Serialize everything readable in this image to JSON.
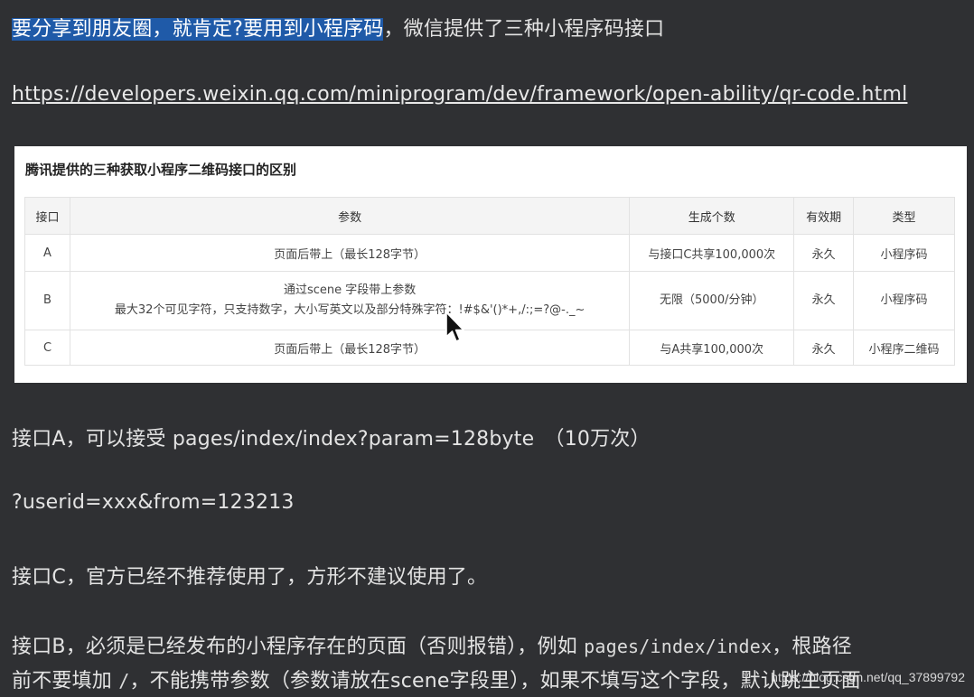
{
  "intro": {
    "highlighted": "要分享到朋友圈，就肯定?要用到小程序码",
    "rest": "，微信提供了三种小程序码接口"
  },
  "link": "https://developers.weixin.qq.com/miniprogram/dev/framework/open-ability/qr-code.html",
  "table": {
    "title": "腾讯提供的三种获取小程序二维码接口的区别",
    "headers": [
      "接口",
      "参数",
      "生成个数",
      "有效期",
      "类型"
    ],
    "rows": [
      {
        "api": "A",
        "param_line1": "页面后带上（最长128字节）",
        "param_line2": "",
        "count": "与接口C共享100,000次",
        "validity": "永久",
        "type": "小程序码"
      },
      {
        "api": "B",
        "param_line1": "通过scene 字段带上参数",
        "param_line2": "最大32个可见字符，只支持数字，大小写英文以及部分特殊字符：!#$&'()*+,/:;=?@-._~",
        "count": "无限（5000/分钟）",
        "validity": "永久",
        "type": "小程序码"
      },
      {
        "api": "C",
        "param_line1": "页面后带上（最长128字节）",
        "param_line2": "",
        "count": "与A共享100,000次",
        "validity": "永久",
        "type": "小程序二维码"
      }
    ]
  },
  "notes": {
    "a": "接口A，可以接受 pages/index/index?param=128byte　（10万次）",
    "query": "?userid=xxx&from=123213",
    "c": "接口C，官方已经不推荐使用了，方形不建议使用了。",
    "b_prefix": "接口B，必须是已经发布的小程序存在的页面（否则报错），例如 ",
    "b_code": "pages/index/index",
    "b_suffix": "，根路径",
    "b2_prefix": "前不要填加 ",
    "b2_code": "/",
    "b2_suffix": "，不能携带参数（参数请放在scene字段里），如果不填写这个字段，默认跳主页面"
  },
  "watermark": "https://blog.csdn.net/qq_37899792"
}
